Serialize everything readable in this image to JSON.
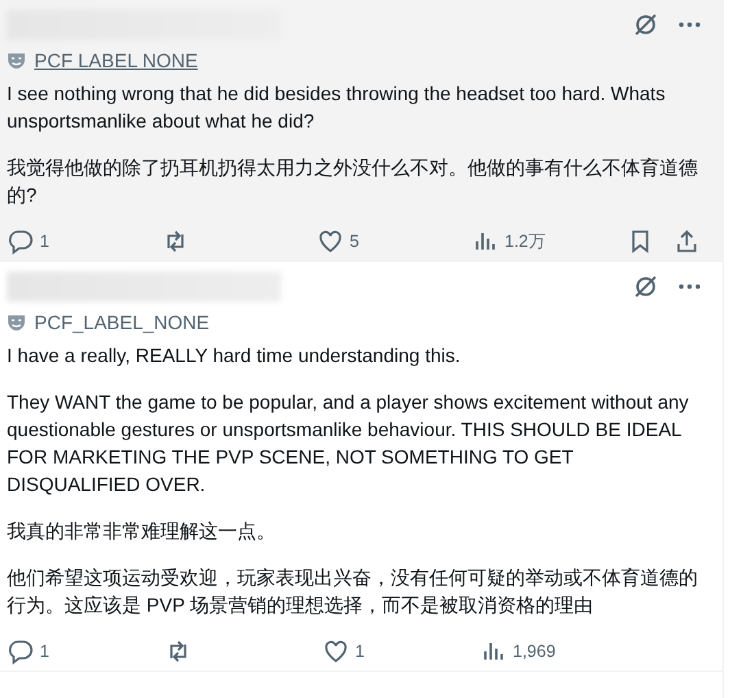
{
  "posts": [
    {
      "hovered": true,
      "label": {
        "text": "PCF LABEL NONE"
      },
      "paragraphs": [
        "I see nothing wrong that he did besides throwing the headset too hard. Whats unsportsmanlike about what he did?",
        "我觉得他做的除了扔耳机扔得太用力之外没什么不对。他做的事有什么不体育道德的?"
      ],
      "actions": [
        {
          "kind": "reply",
          "count": "1"
        },
        {
          "kind": "repost"
        },
        {
          "kind": "like",
          "count": "5"
        },
        {
          "kind": "views",
          "count": "1.2万"
        },
        {
          "kind": "bookmark"
        },
        {
          "kind": "share"
        }
      ]
    },
    {
      "hovered": false,
      "label": {
        "text": "PCF_LABEL_NONE"
      },
      "paragraphs": [
        "I have a really, REALLY hard time understanding this.",
        "They WANT the game to be popular, and a player shows excitement without any questionable gestures or unsportsmanlike behaviour. THIS SHOULD BE IDEAL FOR MARKETING THE PVP SCENE, NOT SOMETHING TO GET DISQUALIFIED OVER.",
        "我真的非常非常难理解这一点。",
        "他们希望这项运动受欢迎，玩家表现出兴奋，没有任何可疑的举动或不体育道德的行为。这应该是 PVP 场景营销的理想选择，而不是被取消资格的理由"
      ],
      "actions": [
        {
          "kind": "reply",
          "count": "1"
        },
        {
          "kind": "repost"
        },
        {
          "kind": "like",
          "count": "1"
        },
        {
          "kind": "views",
          "count": "1,969"
        }
      ]
    }
  ]
}
